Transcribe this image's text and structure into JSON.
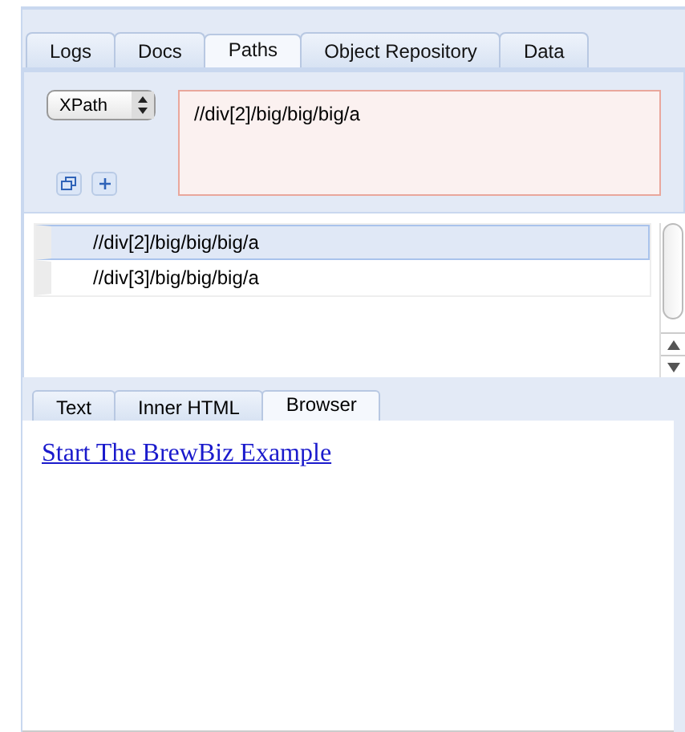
{
  "tabs": [
    {
      "label": "Logs",
      "selected": false
    },
    {
      "label": "Docs",
      "selected": false
    },
    {
      "label": "Paths",
      "selected": true
    },
    {
      "label": "Object Repository",
      "selected": false
    },
    {
      "label": "Data",
      "selected": false
    }
  ],
  "locator": {
    "type": "XPath",
    "value": "//div[2]/big/big/big/a"
  },
  "paths": [
    {
      "text": "//div[2]/big/big/big/a",
      "selected": true
    },
    {
      "text": "//div[3]/big/big/big/a",
      "selected": false
    }
  ],
  "view_tabs": [
    {
      "label": "Text",
      "selected": false
    },
    {
      "label": "Inner HTML",
      "selected": false
    },
    {
      "label": "Browser",
      "selected": true
    }
  ],
  "browser": {
    "link": "Start The BrewBiz Example"
  }
}
